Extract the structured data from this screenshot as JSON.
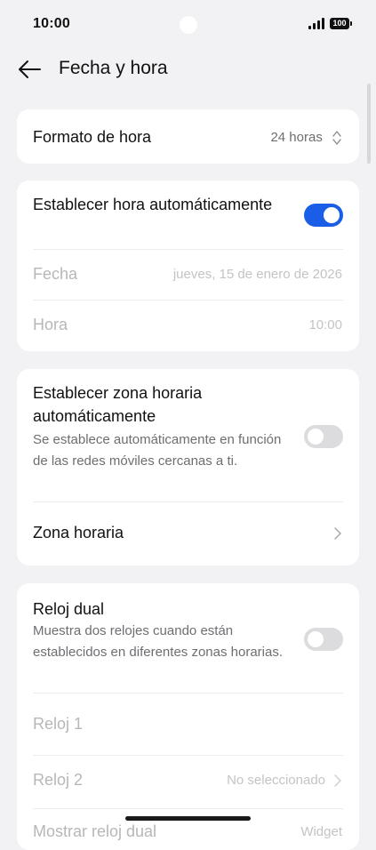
{
  "status_bar": {
    "time": "10:00",
    "battery": "100"
  },
  "header": {
    "title": "Fecha y hora"
  },
  "time_format": {
    "label": "Formato de hora",
    "value": "24 horas"
  },
  "auto_time": {
    "label": "Establecer hora automáticamente",
    "enabled": true,
    "date_label": "Fecha",
    "date_value": "jueves, 15 de enero de 2026",
    "time_label": "Hora",
    "time_value": "10:00"
  },
  "auto_timezone": {
    "label": "Establecer zona horaria automáticamente",
    "description": "Se establece automáticamente en función de las redes móviles cercanas a ti.",
    "enabled": false,
    "timezone_label": "Zona horaria"
  },
  "dual_clock": {
    "label": "Reloj dual",
    "description": "Muestra dos relojes cuando están establecidos en diferentes zonas horarias.",
    "enabled": false,
    "clock1_label": "Reloj 1",
    "clock2_label": "Reloj 2",
    "clock2_value": "No seleccionado",
    "show_label": "Mostrar reloj dual",
    "show_value": "Widget"
  },
  "colors": {
    "accent": "#1a5ee8",
    "background": "#f2f2f4",
    "card": "#ffffff"
  }
}
